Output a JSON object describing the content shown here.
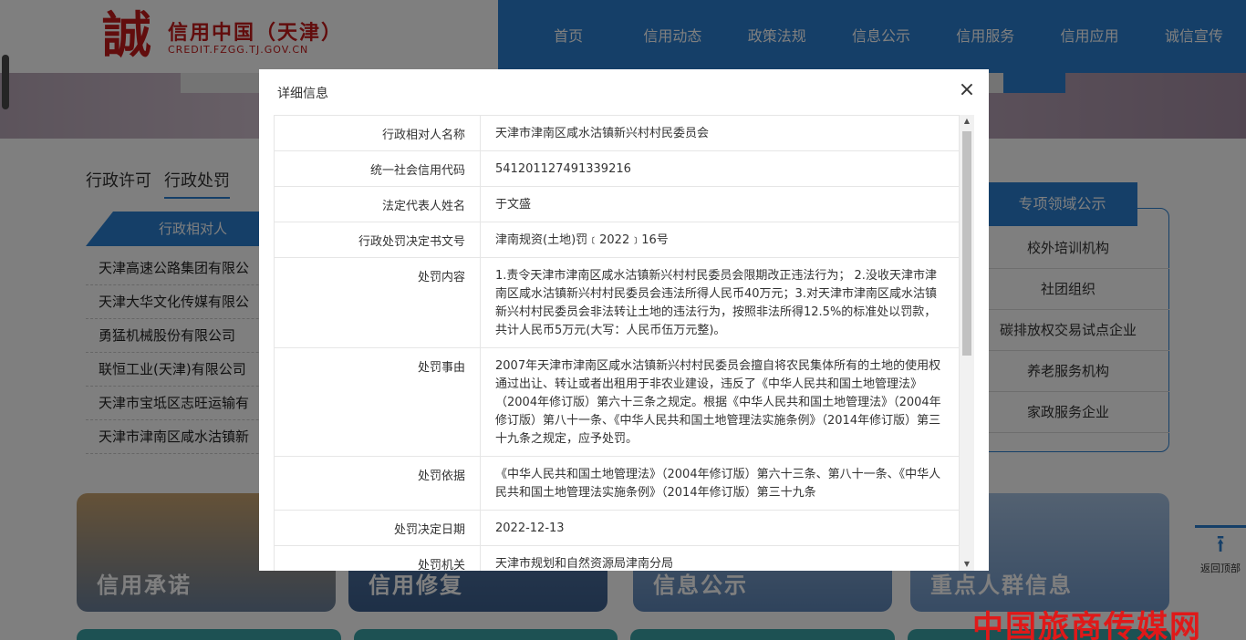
{
  "site": {
    "logo_glyph": "誠",
    "title": "信用中国（天津）",
    "subtitle": "CREDIT.FZGG.TJ.GOV.CN"
  },
  "topnav": [
    "首页",
    "信用动态",
    "政策法规",
    "信息公示",
    "信用服务",
    "信用应用",
    "诚信宣传"
  ],
  "tabs": [
    "行政许可",
    "行政处罚"
  ],
  "list": {
    "head": "行政相对人",
    "items": [
      "天津高速公路集团有限公",
      "天津大华文化传媒有限公",
      "勇猛机械股份有限公司",
      "联恒工业(天津)有限公司",
      "天津市宝坻区志旺运输有",
      "天津市津南区咸水沽镇新"
    ]
  },
  "special": {
    "head": "专项领域公示",
    "items": [
      "校外培训机构",
      "社团组织",
      "碳排放权交易试点企业",
      "养老服务机构",
      "家政服务企业"
    ]
  },
  "cards": [
    "信用承诺",
    "信用修复",
    "信息公示",
    "重点人群信息"
  ],
  "back_top": "返回顶部",
  "modal": {
    "title": "详细信息",
    "close": "×",
    "rows": [
      {
        "label": "行政相对人名称",
        "value": "天津市津南区咸水沽镇新兴村村民委员会"
      },
      {
        "label": "统一社会信用代码",
        "value": "541201127491339216"
      },
      {
        "label": "法定代表人姓名",
        "value": "于文盛"
      },
      {
        "label": "行政处罚决定书文号",
        "value": "津南规资(土地)罚﹝2022﹞16号"
      },
      {
        "label": "处罚内容",
        "value": "1.责令天津市津南区咸水沽镇新兴村村民委员会限期改正违法行为； 2.没收天津市津南区咸水沽镇新兴村村民委员会违法所得人民币40万元；3.对天津市津南区咸水沽镇新兴村村民委员会非法转让土地的违法行为，按照非法所得12.5%的标准处以罚款，共计人民币5万元(大写：人民币伍万元整)。"
      },
      {
        "label": "处罚事由",
        "value": "2007年天津市津南区咸水沽镇新兴村村民委员会擅自将农民集体所有的土地的使用权通过出让、转让或者出租用于非农业建设，违反了《中华人民共和国土地管理法》（2004年修订版）第六十三条之规定。根据《中华人民共和国土地管理法》（2004年修订版）第八十一条、《中华人民共和国土地管理法实施条例》（2014年修订版）第三十九条之规定，应予处罚。"
      },
      {
        "label": "处罚依据",
        "value": "《中华人民共和国土地管理法》（2004年修订版）第六十三条、第八十一条、《中华人民共和国土地管理法实施条例》（2014年修订版）第三十九条"
      },
      {
        "label": "处罚决定日期",
        "value": "2022-12-13"
      },
      {
        "label": "处罚机关",
        "value": "天津市规划和自然资源局津南分局"
      }
    ]
  },
  "watermark": "中国旅商传媒网"
}
